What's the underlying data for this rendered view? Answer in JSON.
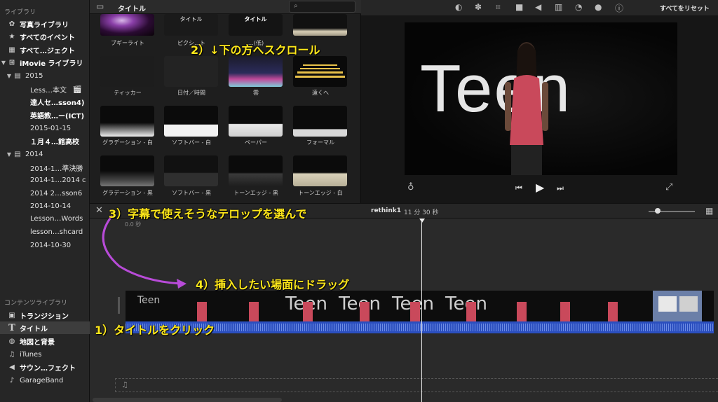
{
  "sidebar": {
    "library_header": "ライブラリ",
    "library_items": [
      {
        "icon": "photos-icon",
        "label": "写真ライブラリ"
      },
      {
        "icon": "star-icon",
        "label": "すべてのイベント"
      },
      {
        "icon": "film-icon",
        "label": "すべて…ジェクト"
      },
      {
        "icon": "grid-icon",
        "label": "iMovie ライブラリ"
      },
      {
        "icon": "calendar-icon",
        "label": "2015"
      },
      {
        "icon": "",
        "label": "Less…本文"
      },
      {
        "icon": "",
        "label": "達人セ…sson4)"
      },
      {
        "icon": "",
        "label": "英語教…ー(ICT)"
      },
      {
        "icon": "",
        "label": "2015-01-15"
      },
      {
        "icon": "",
        "label": "１月４…館高校"
      },
      {
        "icon": "calendar-icon",
        "label": "2014"
      },
      {
        "icon": "",
        "label": "2014-1…準決勝"
      },
      {
        "icon": "",
        "label": "2014-1…2014 c"
      },
      {
        "icon": "",
        "label": "2014 2…sson6"
      },
      {
        "icon": "",
        "label": "2014-10-14"
      },
      {
        "icon": "",
        "label": "Lesson…Words"
      },
      {
        "icon": "",
        "label": "lesson…shcard"
      },
      {
        "icon": "",
        "label": "2014-10-30"
      }
    ],
    "content_header": "コンテンツライブラリ",
    "content_items": [
      {
        "icon": "transition-icon",
        "label": "トランジション"
      },
      {
        "icon": "title-t-icon",
        "label": "タイトル"
      },
      {
        "icon": "globe-icon",
        "label": "地図と背景"
      },
      {
        "icon": "music-note-icon",
        "label": "iTunes"
      },
      {
        "icon": "speaker-icon",
        "label": "サウン…フェクト"
      },
      {
        "icon": "guitar-icon",
        "label": "GarageBand"
      }
    ]
  },
  "browser": {
    "title": "タイトル",
    "thumb_text_1": "タイトル",
    "thumb_text_2": "タイトル",
    "titles": [
      [
        "ブギーライト",
        "ピクシ…ト",
        "…(低)",
        ""
      ],
      [
        "ティッカー",
        "日付／時間",
        "雲",
        "遠くへ"
      ],
      [
        "グラデーション - 白",
        "ソフトバー - 白",
        "ペーパー",
        "フォーマル"
      ],
      [
        "グラデーション - 黒",
        "ソフトバー - 黒",
        "トーンエッジ - 黒",
        "トーンエッジ - 白"
      ]
    ]
  },
  "viewer": {
    "reset_label": "すべてをリセット",
    "video_text": "Teen"
  },
  "timeline": {
    "project_name": "rethink1",
    "duration": "11 分 30 秒",
    "ruler_start": "0.0 秒",
    "clip_text": "Teen"
  },
  "annotations": {
    "step1": "1）タイトルをクリック",
    "step2": "2）↓下の方へスクロール",
    "step3": "3）字幕で使えそうなテロップを選んで",
    "step4": "4）挿入したい場面にドラッグ"
  },
  "colors": {
    "accent_yellow": "#ffe81a",
    "annotation_arrow": "#b84bd8",
    "audio_blue": "#2b4fbf",
    "shirt_red": "#c9495b"
  }
}
